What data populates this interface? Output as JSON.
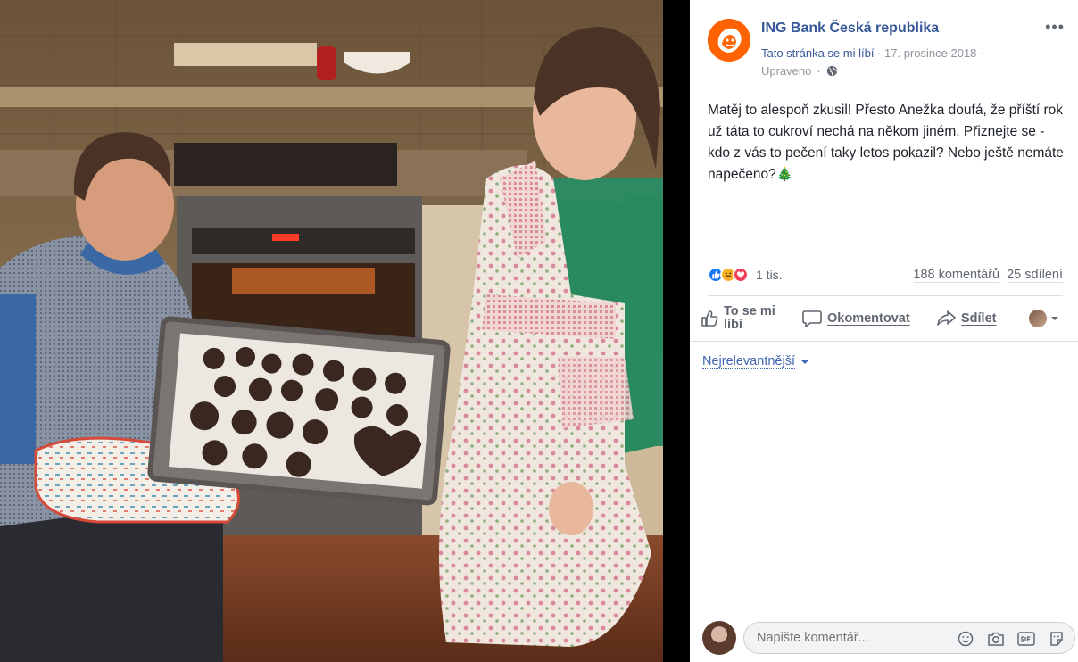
{
  "post": {
    "page_name": "ING Bank Česká republika",
    "like_page_label": "Tato stránka se mi líbí",
    "separator": "·",
    "date": "17. prosince 2018",
    "edited_label": "Upraveno",
    "more_label": "•••",
    "text": "Matěj to alespoň zkusil! Přesto Anežka doufá, že příští rok už táta to cukroví nechá na někom jiném. Přiznejte se - kdo z vás to pečení taky letos pokazil? Nebo ještě nemáte napečeno?🎄"
  },
  "stats": {
    "reactions_count": "1 tis.",
    "comments": "188 komentářů",
    "shares": "25 sdílení",
    "reaction_types": [
      "like-icon",
      "haha-icon",
      "love-icon"
    ]
  },
  "actions": {
    "like": "To se mi líbí",
    "comment": "Okomentovat",
    "share": "Sdílet"
  },
  "comments": {
    "sort_label": "Nejrelevantnější",
    "composer_placeholder": "Napište komentář..."
  },
  "colors": {
    "brand_orange": "#ff6200",
    "link_blue": "#365899",
    "reaction_like": "#1877f2",
    "reaction_haha": "#f7b125",
    "reaction_love": "#f33e58"
  }
}
